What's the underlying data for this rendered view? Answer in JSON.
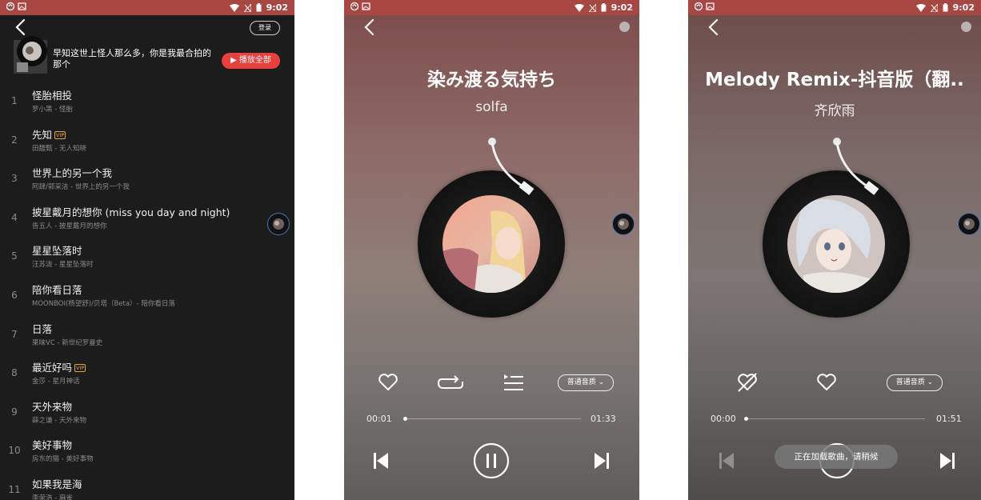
{
  "status_bar": {
    "time": "9:02"
  },
  "playlist_screen": {
    "login_label": "登录",
    "playlist_title": "早知这世上怪人那么多，你是我最合拍的那个",
    "play_all_label": "▶ 播放全部",
    "vip_badge": "VIP",
    "songs": [
      {
        "num": "1",
        "title": "怪胎相投",
        "subtitle": "罗小黑 - 怪胎"
      },
      {
        "num": "2",
        "title": "先知",
        "subtitle": "田馥甄 - 无人知晓"
      },
      {
        "num": "3",
        "title": "世界上的另一个我",
        "subtitle": "阿肆/郭采洁 - 世界上的另一个我"
      },
      {
        "num": "4",
        "title": "披星戴月的想你 (miss you day and night)",
        "subtitle": "告五人 - 披星戴月的想你"
      },
      {
        "num": "5",
        "title": "星星坠落时",
        "subtitle": "汪苏泷 - 星星坠落时"
      },
      {
        "num": "6",
        "title": "陪你看日落",
        "subtitle": "MOONBOI(杨望舒)/贝塔（Beta）- 陪你看日落"
      },
      {
        "num": "7",
        "title": "日落",
        "subtitle": "果味VC - 新世纪罗曼史"
      },
      {
        "num": "8",
        "title": "最近好吗",
        "subtitle": "金莎 - 星月神话"
      },
      {
        "num": "9",
        "title": "天外来物",
        "subtitle": "薛之谦 - 天外来物"
      },
      {
        "num": "10",
        "title": "美好事物",
        "subtitle": "房东的猫 - 美好事物"
      },
      {
        "num": "11",
        "title": "如果我是海",
        "subtitle": "李荣浩 - 麻雀"
      }
    ]
  },
  "player_screen_1": {
    "title": "染み渡る気持ち",
    "artist": "solfa",
    "quality_label": "普通音质",
    "elapsed": "00:01",
    "duration": "01:33",
    "progress": 0.0108
  },
  "player_screen_2": {
    "title": "Melody Remix-抖音版（翻..",
    "artist": "齐欣雨",
    "quality_label": "普通音质",
    "elapsed": "00:00",
    "duration": "01:51",
    "progress": 0.0,
    "toast": "正在加载歌曲，请稍候"
  }
}
